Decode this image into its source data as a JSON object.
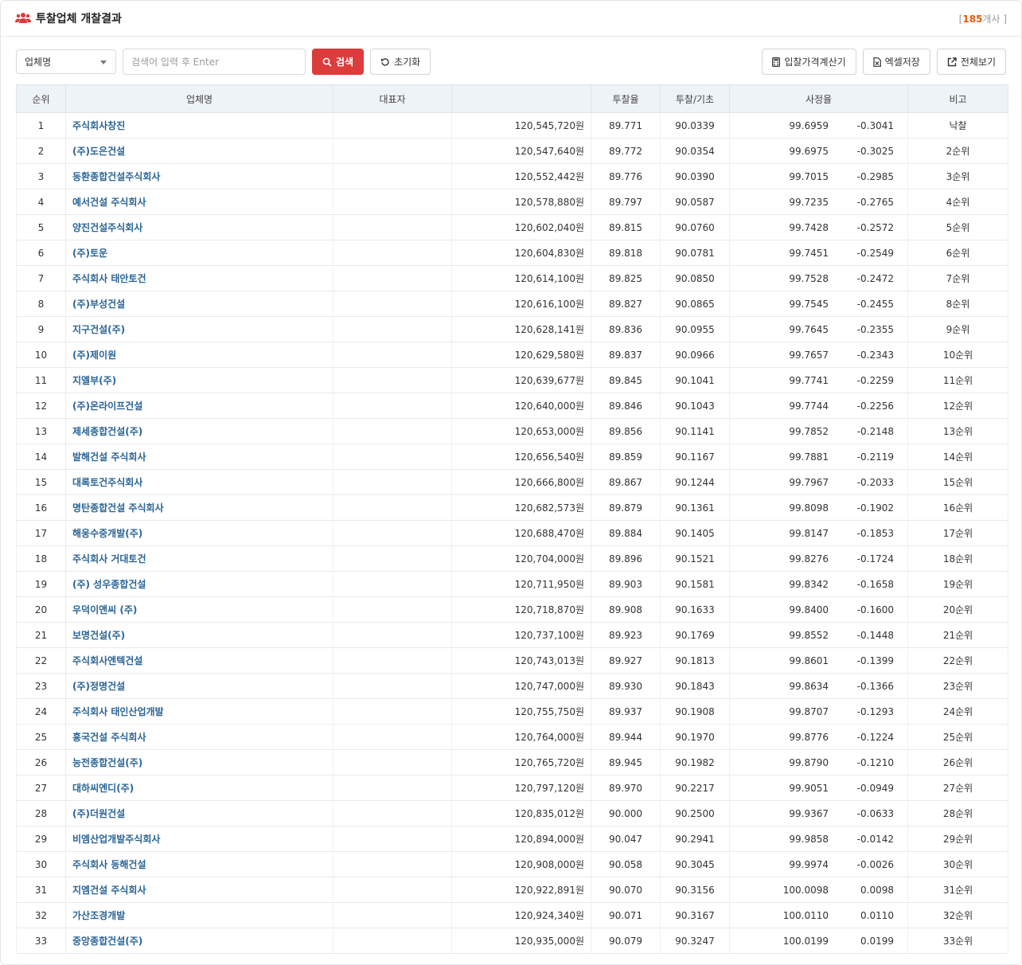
{
  "header": {
    "title": "투찰업체 개찰결과",
    "count_open": "[",
    "count": "185",
    "count_unit": "개사 ]"
  },
  "toolbar": {
    "select_value": "업체명",
    "search_placeholder": "검색어 입력 후 Enter",
    "search_label": "검색",
    "reset_label": "초기화",
    "calc_label": "입찰가격계산기",
    "excel_label": "엑셀저장",
    "fullview_label": "전체보기"
  },
  "table": {
    "headers": [
      "순위",
      "업체명",
      "대표자",
      "",
      "투찰율",
      "투찰/기초",
      "사정율",
      "비고"
    ],
    "rows": [
      [
        "1",
        "주식회사창진",
        "",
        "120,545,720원",
        "89.771",
        "90.0339",
        "99.6959",
        "-0.3041",
        "낙찰"
      ],
      [
        "2",
        "(주)도은건설",
        "",
        "120,547,640원",
        "89.772",
        "90.0354",
        "99.6975",
        "-0.3025",
        "2순위"
      ],
      [
        "3",
        "동환종합건설주식회사",
        "",
        "120,552,442원",
        "89.776",
        "90.0390",
        "99.7015",
        "-0.2985",
        "3순위"
      ],
      [
        "4",
        "예서건설 주식회사",
        "",
        "120,578,880원",
        "89.797",
        "90.0587",
        "99.7235",
        "-0.2765",
        "4순위"
      ],
      [
        "5",
        "양진건설주식회사",
        "",
        "120,602,040원",
        "89.815",
        "90.0760",
        "99.7428",
        "-0.2572",
        "5순위"
      ],
      [
        "6",
        "(주)토운",
        "",
        "120,604,830원",
        "89.818",
        "90.0781",
        "99.7451",
        "-0.2549",
        "6순위"
      ],
      [
        "7",
        "주식회사 태안토건",
        "",
        "120,614,100원",
        "89.825",
        "90.0850",
        "99.7528",
        "-0.2472",
        "7순위"
      ],
      [
        "8",
        "(주)부성건설",
        "",
        "120,616,100원",
        "89.827",
        "90.0865",
        "99.7545",
        "-0.2455",
        "8순위"
      ],
      [
        "9",
        "지구건설(주)",
        "",
        "120,628,141원",
        "89.836",
        "90.0955",
        "99.7645",
        "-0.2355",
        "9순위"
      ],
      [
        "10",
        "(주)제이원",
        "",
        "120,629,580원",
        "89.837",
        "90.0966",
        "99.7657",
        "-0.2343",
        "10순위"
      ],
      [
        "11",
        "지엘부(주)",
        "",
        "120,639,677원",
        "89.845",
        "90.1041",
        "99.7741",
        "-0.2259",
        "11순위"
      ],
      [
        "12",
        "(주)온라이프건설",
        "",
        "120,640,000원",
        "89.846",
        "90.1043",
        "99.7744",
        "-0.2256",
        "12순위"
      ],
      [
        "13",
        "제세종합건설(주)",
        "",
        "120,653,000원",
        "89.856",
        "90.1141",
        "99.7852",
        "-0.2148",
        "13순위"
      ],
      [
        "14",
        "발해건설 주식회사",
        "",
        "120,656,540원",
        "89.859",
        "90.1167",
        "99.7881",
        "-0.2119",
        "14순위"
      ],
      [
        "15",
        "대록토건주식회사",
        "",
        "120,666,800원",
        "89.867",
        "90.1244",
        "99.7967",
        "-0.2033",
        "15순위"
      ],
      [
        "16",
        "명탄종합건설 주식회사",
        "",
        "120,682,573원",
        "89.879",
        "90.1361",
        "99.8098",
        "-0.1902",
        "16순위"
      ],
      [
        "17",
        "해웅수중개발(주)",
        "",
        "120,688,470원",
        "89.884",
        "90.1405",
        "99.8147",
        "-0.1853",
        "17순위"
      ],
      [
        "18",
        "주식회사 거대토건",
        "",
        "120,704,000원",
        "89.896",
        "90.1521",
        "99.8276",
        "-0.1724",
        "18순위"
      ],
      [
        "19",
        "(주) 성우종합건설",
        "",
        "120,711,950원",
        "89.903",
        "90.1581",
        "99.8342",
        "-0.1658",
        "19순위"
      ],
      [
        "20",
        "우덕이앤씨 (주)",
        "",
        "120,718,870원",
        "89.908",
        "90.1633",
        "99.8400",
        "-0.1600",
        "20순위"
      ],
      [
        "21",
        "보명건설(주)",
        "",
        "120,737,100원",
        "89.923",
        "90.1769",
        "99.8552",
        "-0.1448",
        "21순위"
      ],
      [
        "22",
        "주식회사엔텍건설",
        "",
        "120,743,013원",
        "89.927",
        "90.1813",
        "99.8601",
        "-0.1399",
        "22순위"
      ],
      [
        "23",
        "(주)정명건설",
        "",
        "120,747,000원",
        "89.930",
        "90.1843",
        "99.8634",
        "-0.1366",
        "23순위"
      ],
      [
        "24",
        "주식회사 태인산업개발",
        "",
        "120,755,750원",
        "89.937",
        "90.1908",
        "99.8707",
        "-0.1293",
        "24순위"
      ],
      [
        "25",
        "흥국건설 주식회사",
        "",
        "120,764,000원",
        "89.944",
        "90.1970",
        "99.8776",
        "-0.1224",
        "25순위"
      ],
      [
        "26",
        "능전종합건설(주)",
        "",
        "120,765,720원",
        "89.945",
        "90.1982",
        "99.8790",
        "-0.1210",
        "26순위"
      ],
      [
        "27",
        "대하씨엔디(주)",
        "",
        "120,797,120원",
        "89.970",
        "90.2217",
        "99.9051",
        "-0.0949",
        "27순위"
      ],
      [
        "28",
        "(주)더원건설",
        "",
        "120,835,012원",
        "90.000",
        "90.2500",
        "99.9367",
        "-0.0633",
        "28순위"
      ],
      [
        "29",
        "비엠산업개발주식회사",
        "",
        "120,894,000원",
        "90.047",
        "90.2941",
        "99.9858",
        "-0.0142",
        "29순위"
      ],
      [
        "30",
        "주식회사 동해건설",
        "",
        "120,908,000원",
        "90.058",
        "90.3045",
        "99.9974",
        "-0.0026",
        "30순위"
      ],
      [
        "31",
        "지엠건설 주식회사",
        "",
        "120,922,891원",
        "90.070",
        "90.3156",
        "100.0098",
        "0.0098",
        "31순위"
      ],
      [
        "32",
        "가산조경개발",
        "",
        "120,924,340원",
        "90.071",
        "90.3167",
        "100.0110",
        "0.0110",
        "32순위"
      ],
      [
        "33",
        "중앙종합건설(주)",
        "",
        "120,935,000원",
        "90.079",
        "90.3247",
        "100.0199",
        "0.0199",
        "33순위"
      ]
    ]
  },
  "colors": {
    "accent": "#dc3c3c",
    "link": "#2a6496",
    "count": "#e8590c",
    "header_bg": "#eef3f8"
  }
}
